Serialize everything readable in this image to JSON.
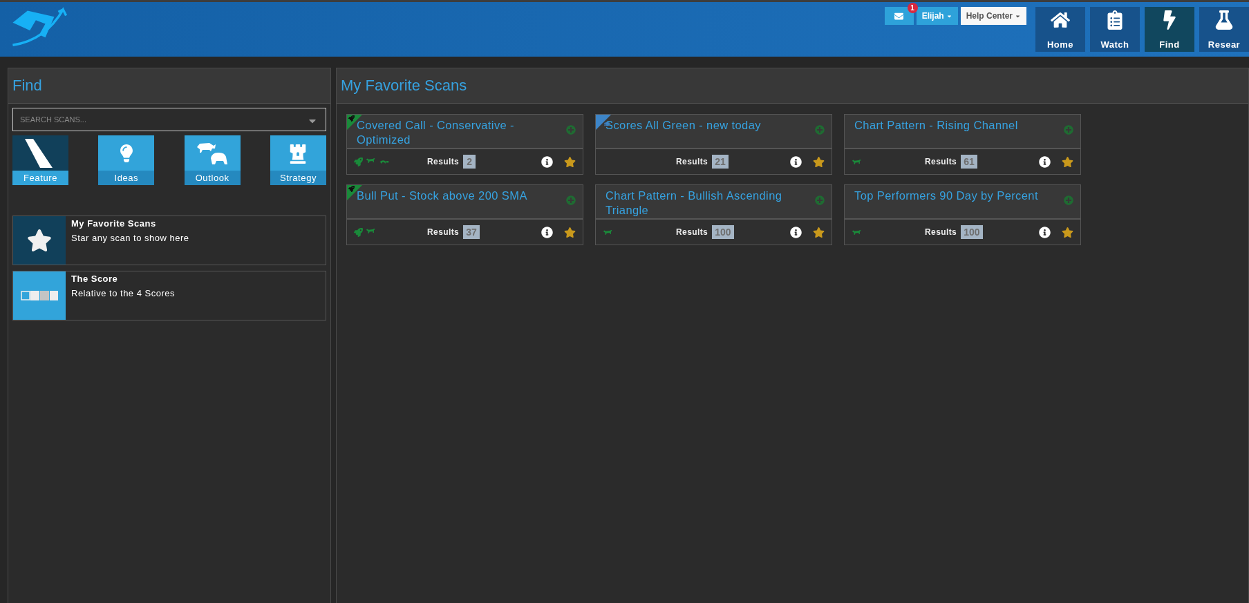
{
  "header": {
    "mail": {
      "count": "1"
    },
    "user_menu": "Elijah",
    "help_menu": "Help Center",
    "nav": [
      {
        "label": "Home",
        "selected": false
      },
      {
        "label": "Watch",
        "selected": false
      },
      {
        "label": "Find",
        "selected": true
      },
      {
        "label": "Resear",
        "selected": false
      }
    ]
  },
  "find_panel": {
    "title": "Find",
    "search": {
      "placeholder": "SEARCH SCANS..."
    },
    "categories": [
      {
        "label": "Feature",
        "kind": "feature"
      },
      {
        "label": "Ideas",
        "kind": "ideas"
      },
      {
        "label": "Outlook",
        "kind": "outlook"
      },
      {
        "label": "Strategy",
        "kind": "strategy"
      }
    ],
    "lists": [
      {
        "title": "My Favorite Scans",
        "subtitle": "Star any scan to show here",
        "kind": "favorites"
      },
      {
        "title": "The Score",
        "subtitle": "Relative to the 4 Scores",
        "kind": "score"
      }
    ]
  },
  "scans_panel": {
    "title": "My Favorite Scans",
    "scans": [
      {
        "title": "Covered Call - Conservative - Optimized",
        "corner": {
          "kind": "rocket"
        },
        "badges": [
          {
            "kind": "rocket"
          },
          {
            "kind": "bull"
          },
          {
            "kind": "turtle"
          }
        ],
        "results_label": "Results",
        "results": "2",
        "starred": true
      },
      {
        "title": "Scores All Green - new today",
        "corner": {
          "kind": "cap"
        },
        "results_label": "Results",
        "results": "21",
        "starred": true
      },
      {
        "title": "Chart Pattern - Rising Channel",
        "badges": [
          {
            "kind": "bull"
          }
        ],
        "results_label": "Results",
        "results": "61",
        "starred": true
      },
      {
        "title": "Bull Put - Stock above 200 SMA",
        "corner": {
          "kind": "rocket"
        },
        "badges": [
          {
            "kind": "rocket"
          },
          {
            "kind": "bull"
          }
        ],
        "results_label": "Results",
        "results": "37",
        "starred": true
      },
      {
        "title": "Chart Pattern - Bullish Ascending Triangle",
        "badges": [
          {
            "kind": "bull"
          }
        ],
        "results_label": "Results",
        "results": "100",
        "starred": true
      },
      {
        "title": "Top Performers 90 Day by Percent",
        "badges": [
          {
            "kind": "bull"
          }
        ],
        "results_label": "Results",
        "results": "100",
        "starred": true
      }
    ]
  }
}
